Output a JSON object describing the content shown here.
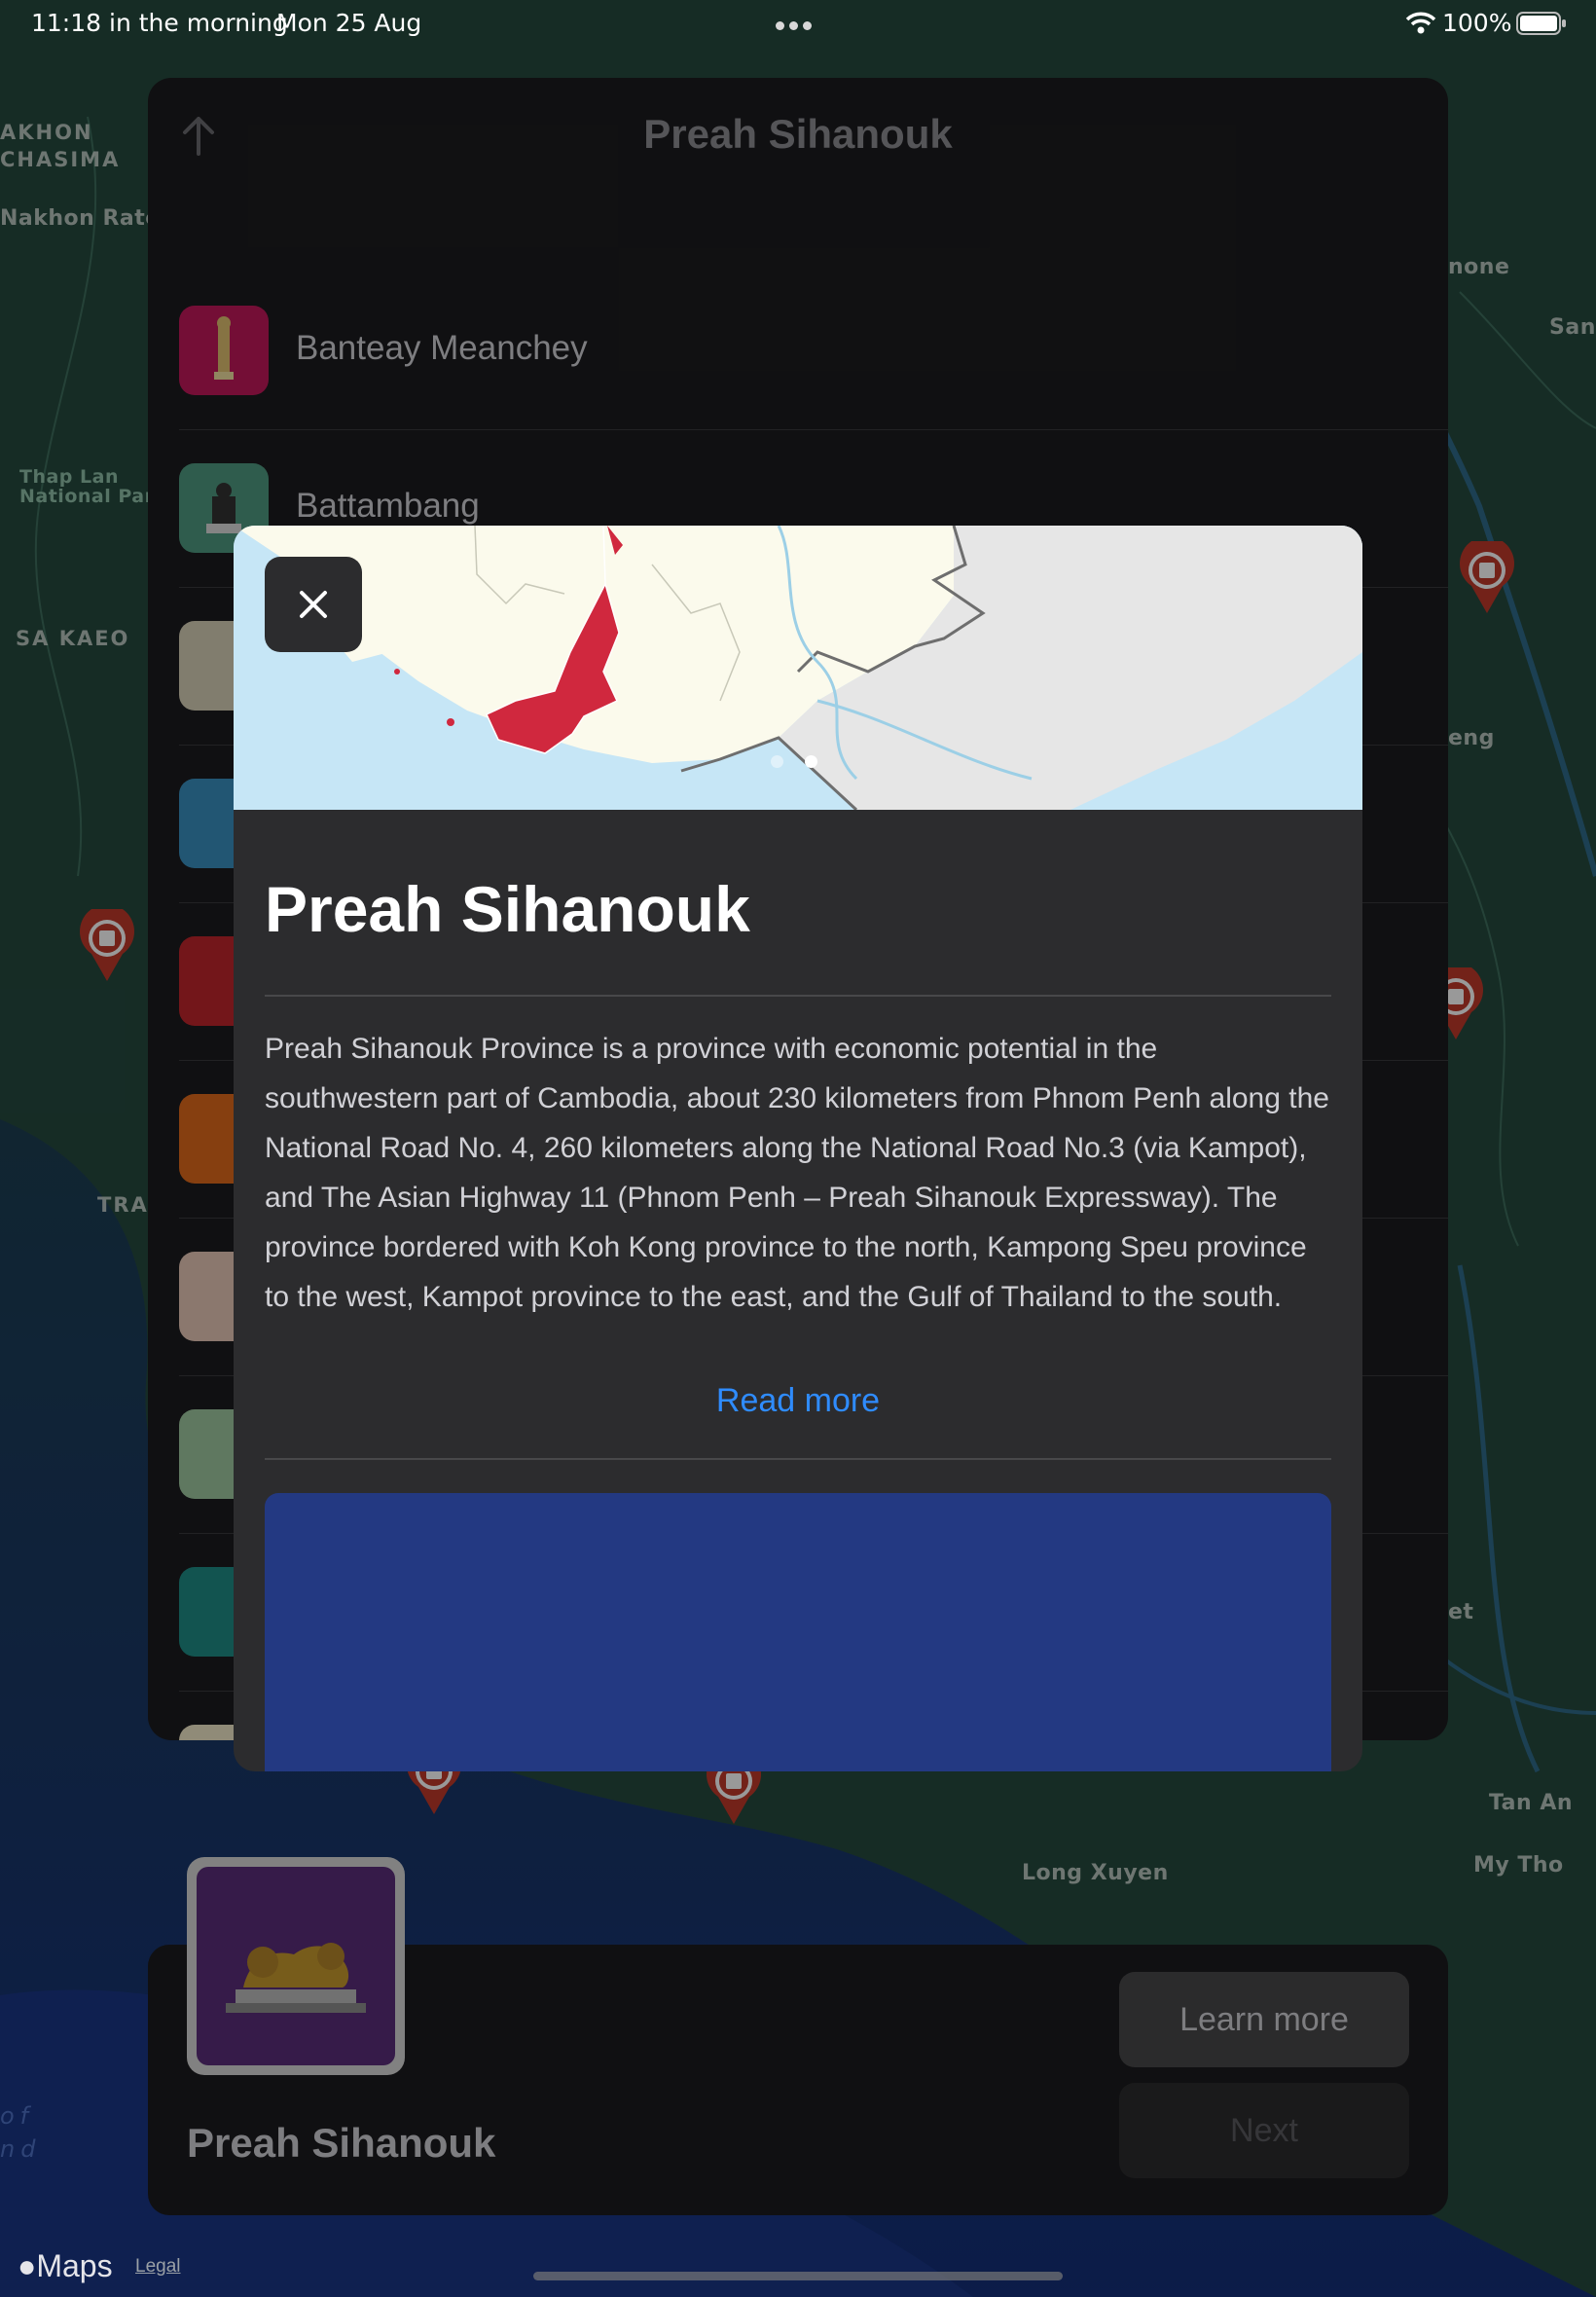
{
  "status_bar": {
    "time": "11:18 in the morning",
    "date": "Mon 25 Aug",
    "battery": "100%",
    "wifi_icon": "wifi-icon",
    "battery_icon": "battery-full-icon",
    "multitask_icon": "ellipsis-icon"
  },
  "map": {
    "labels": [
      "AKHON",
      "CHASIMA",
      "Nakhon Ratch",
      "Thap Lan",
      "National Park",
      "SA KAEO",
      "TRA",
      "none",
      "Sana",
      "eng",
      "et",
      "Tan An",
      "My Tho",
      "Long Xuyen",
      "of",
      "nd"
    ]
  },
  "list": {
    "title": "Preah Sihanouk",
    "up_icon": "arrow-up-icon",
    "items": [
      {
        "label": "Banteay Meanchey"
      },
      {
        "label": "Battambang"
      }
    ]
  },
  "modal": {
    "close_icon": "close-icon",
    "title": "Preah Sihanouk",
    "description": "Preah Sihanouk Province is a province with economic potential in the southwestern part of Cambodia, about 230 kilometers from Phnom Penh along the National Road No. 4, 260 kilometers along the National Road No.3 (via Kampot), and The Asian Highway 11 (Phnom Penh – Preah Sihanouk Expressway). The province bordered with Koh Kong province to the north, Kampong Speu province to the west, Kampot province to the east, and the Gulf of Thailand to the south.",
    "read_more": "Read more",
    "carousel_pages": 2,
    "carousel_current": 2,
    "accent": "#2f8cff",
    "highlight_color": "#d0283e"
  },
  "bottom_card": {
    "name": "Preah Sihanouk",
    "learn_more": "Learn more",
    "next": "Next"
  },
  "footer": {
    "maps": "Maps",
    "legal": "Legal"
  }
}
